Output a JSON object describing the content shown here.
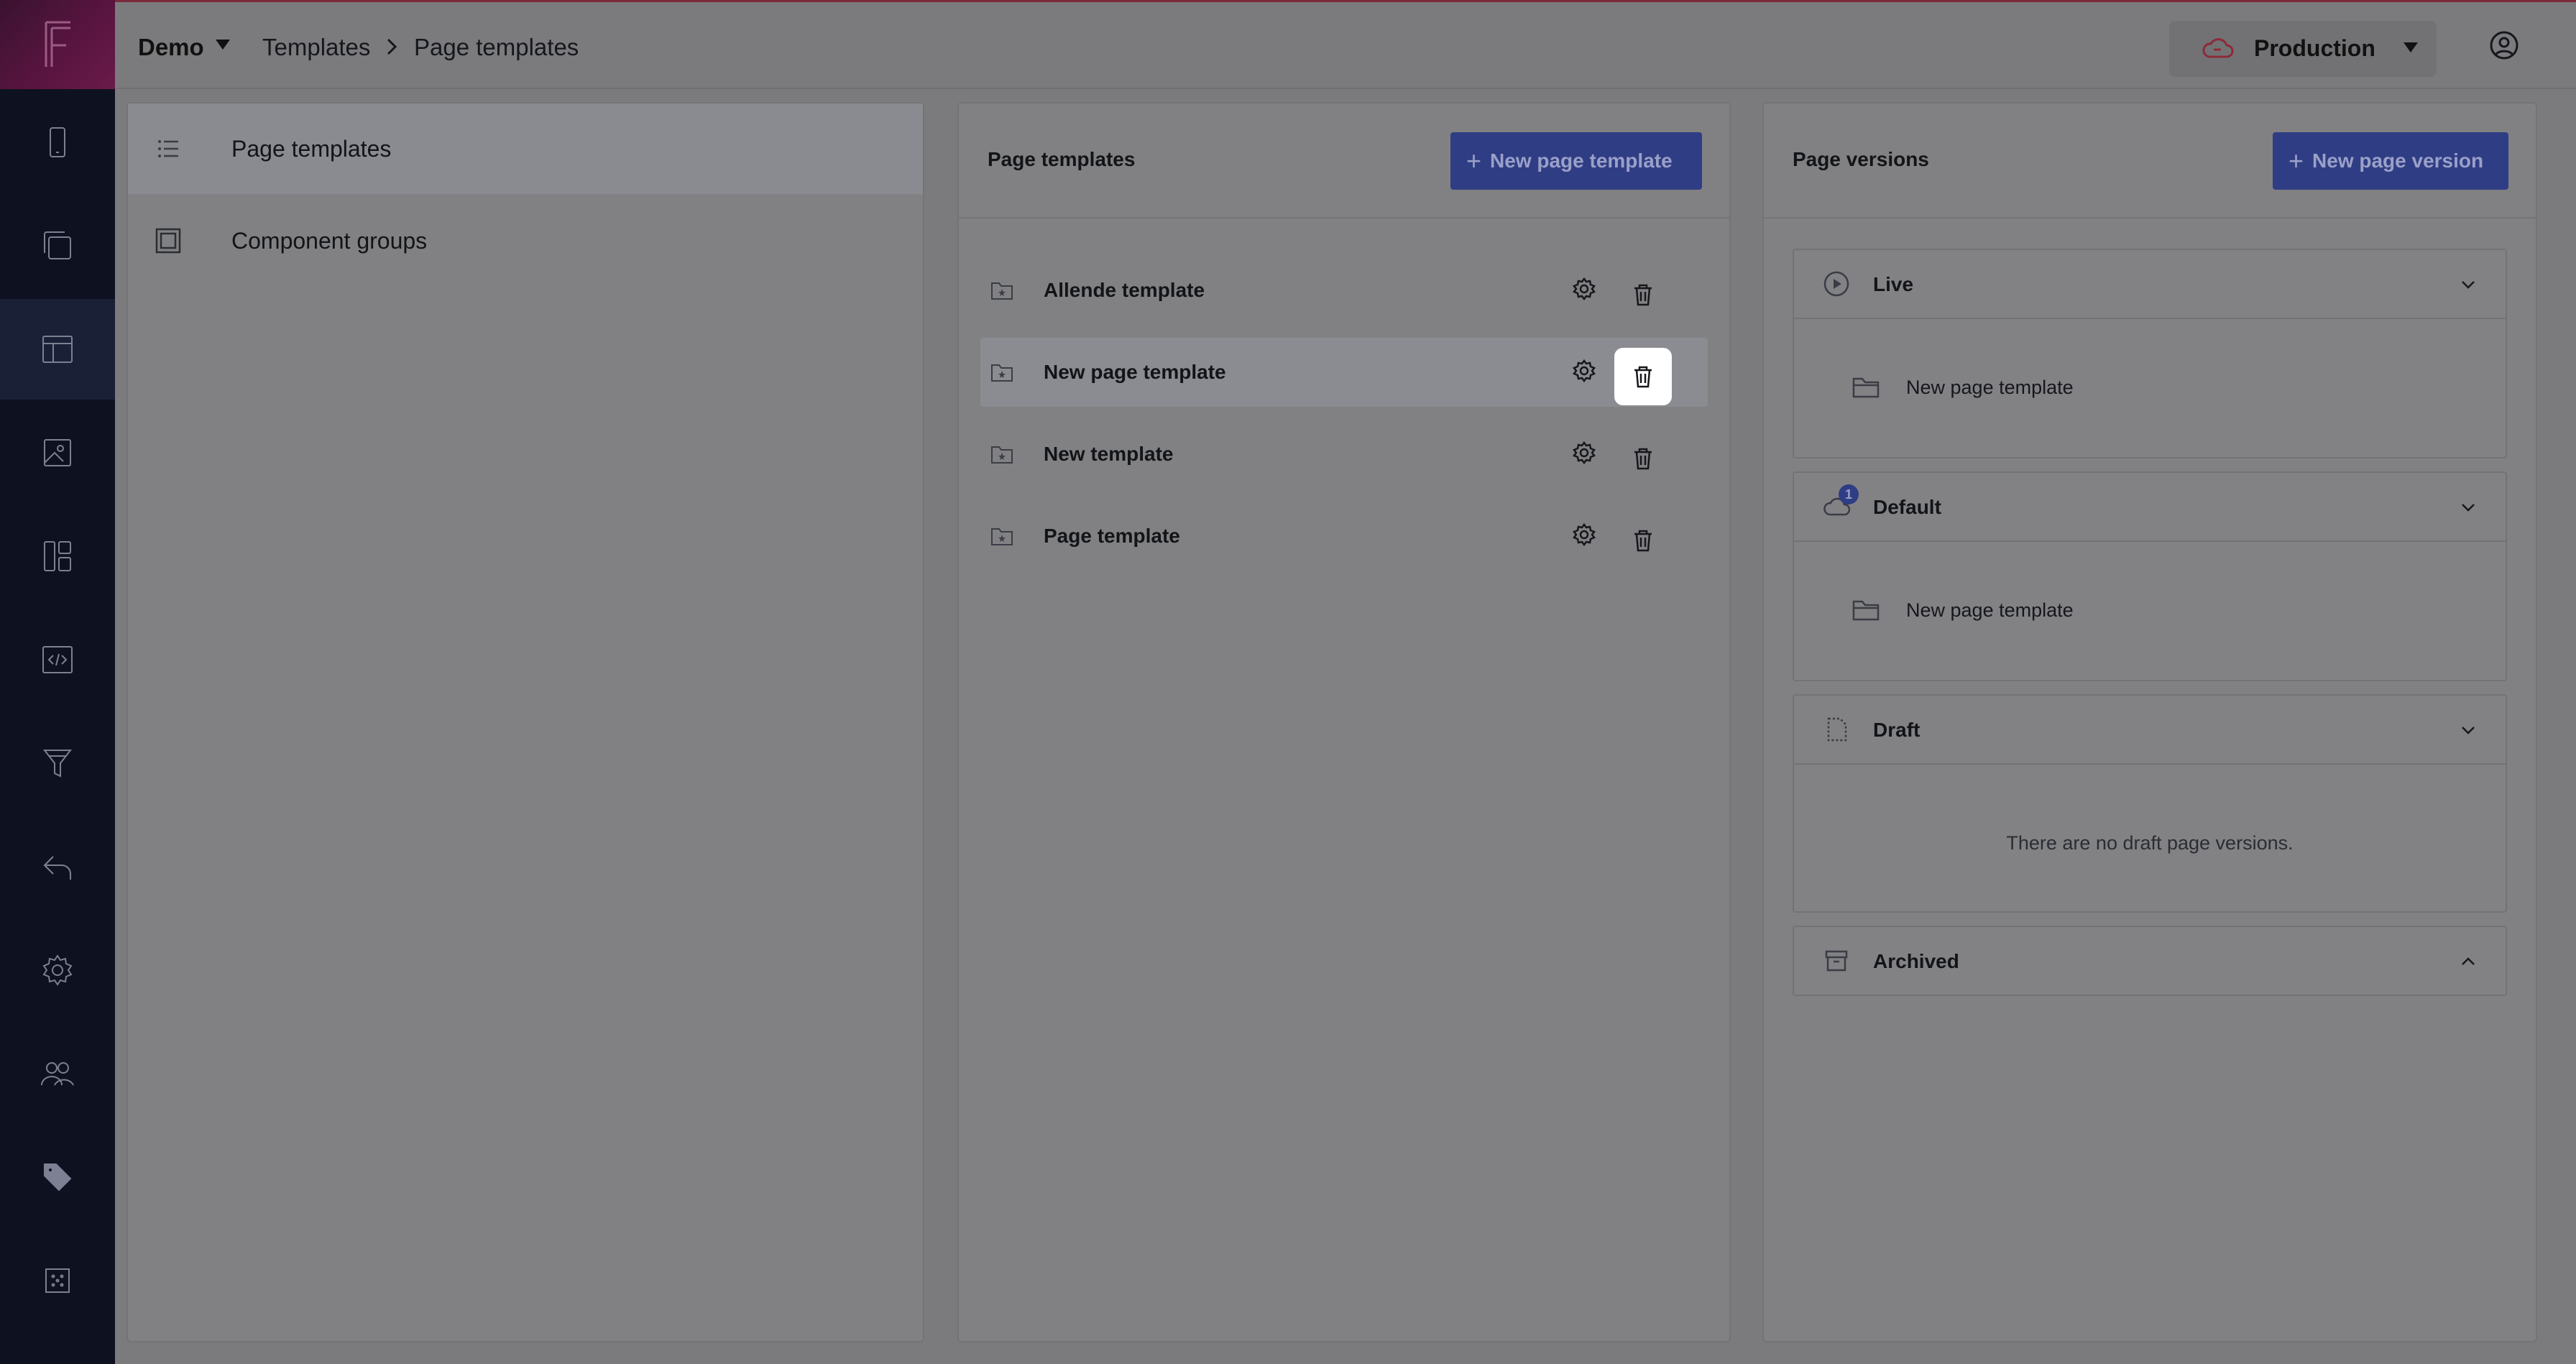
{
  "topbar": {
    "project": "Demo",
    "breadcrumb": [
      "Templates",
      "Page templates"
    ],
    "environment": "Production"
  },
  "left_nav": {
    "items": [
      {
        "label": "Page templates",
        "icon": "list-icon",
        "active": true
      },
      {
        "label": "Component groups",
        "icon": "component-box-icon",
        "active": false
      }
    ]
  },
  "templates_panel": {
    "title": "Page templates",
    "new_button": "New page template",
    "rows": [
      {
        "name": "Allende template"
      },
      {
        "name": "New page template"
      },
      {
        "name": "New template"
      },
      {
        "name": "Page template"
      }
    ]
  },
  "versions_panel": {
    "title": "Page versions",
    "new_button": "New page version",
    "sections": {
      "live": {
        "title": "Live",
        "item": "New page template"
      },
      "default": {
        "title": "Default",
        "badge": "1",
        "item": "New page template"
      },
      "draft": {
        "title": "Draft",
        "empty": "There are no draft page versions."
      },
      "archived": {
        "title": "Archived"
      }
    }
  },
  "colors": {
    "primary_button": "#2f3d84",
    "rail": "#0e1220",
    "overlay": "#7b7b7d"
  }
}
